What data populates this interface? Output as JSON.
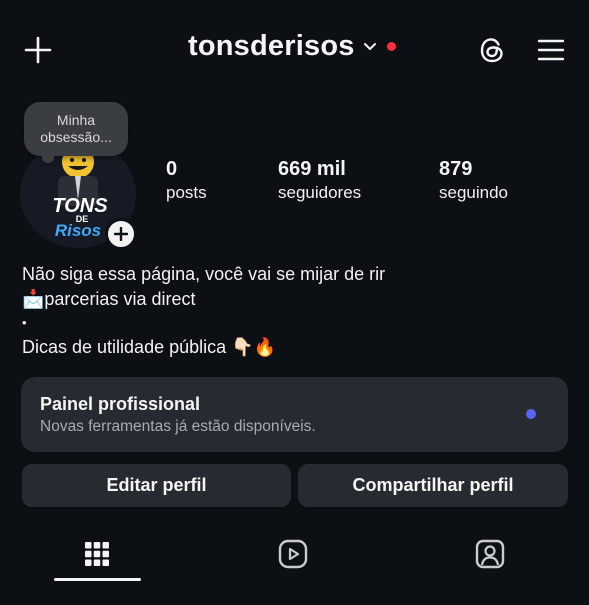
{
  "header": {
    "username": "tonsderisos",
    "icons": [
      "plus-icon",
      "chevron-down-icon",
      "threads-icon",
      "menu-icon"
    ],
    "notification_color": "#ff2d3d"
  },
  "profile": {
    "note": "Minha obsessão...",
    "avatar_text_top": "TONS",
    "avatar_text_mid": "DE",
    "avatar_text_bottom": "Risos"
  },
  "stats": [
    {
      "value": "0",
      "label": "posts"
    },
    {
      "value": "669 mil",
      "label": "seguidores"
    },
    {
      "value": "879",
      "label": "seguindo"
    }
  ],
  "bio": {
    "line1": "Não siga essa página, você vai se mijar de rir",
    "line2": "📩parcerias via direct",
    "line3": "•",
    "line4": "Dicas de utilidade pública 👇🏻🔥"
  },
  "panel": {
    "title": "Painel profissional",
    "subtitle": "Novas ferramentas já estão disponíveis.",
    "dot_color": "#5865f2"
  },
  "actions": {
    "edit": "Editar perfil",
    "share": "Compartilhar perfil"
  },
  "tabs": [
    {
      "name": "grid-icon",
      "selected": true
    },
    {
      "name": "reels-icon",
      "selected": false
    },
    {
      "name": "tagged-icon",
      "selected": false
    }
  ]
}
